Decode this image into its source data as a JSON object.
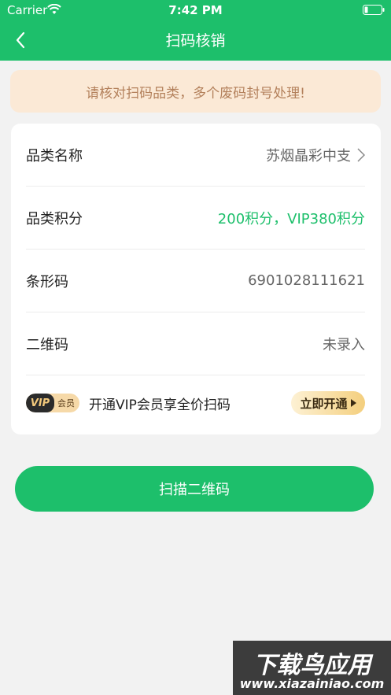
{
  "status_bar": {
    "carrier": "Carrier",
    "time": "7:42 PM"
  },
  "nav": {
    "title": "扫码核销",
    "back_icon": "chevron-left-icon"
  },
  "notice": "请核对扫码品类，多个废码封号处理!",
  "rows": [
    {
      "label": "品类名称",
      "value": "苏烟晶彩中支",
      "has_chevron": true
    },
    {
      "label": "品类积分",
      "value": "200积分，VIP380积分",
      "color": "#1dbf6b"
    },
    {
      "label": "条形码",
      "value": "6901028111621"
    },
    {
      "label": "二维码",
      "value": "未录入"
    }
  ],
  "vip": {
    "badge_left": "VIP",
    "badge_right": "会员",
    "text": "开通VIP会员享全价扫码",
    "button": "立即开通"
  },
  "scan_button": "扫描二维码",
  "watermark": {
    "title": "下载鸟应用",
    "url": "www.xiazainiao.com"
  },
  "colors": {
    "primary": "#1dbf6b",
    "notice_bg": "#fbe9d6",
    "notice_text": "#b3805b"
  }
}
